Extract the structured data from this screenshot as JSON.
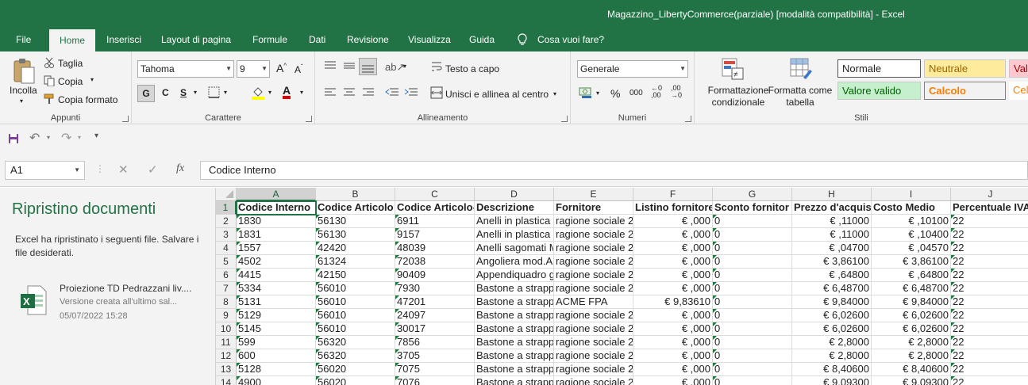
{
  "window": {
    "title": "Magazzino_LibertyCommerce(parziale)  [modalità compatibilità]  -  Excel"
  },
  "tabs": [
    "File",
    "Home",
    "Inserisci",
    "Layout di pagina",
    "Formule",
    "Dati",
    "Revisione",
    "Visualizza",
    "Guida",
    "Cosa vuoi fare?"
  ],
  "ribbon": {
    "clipboard": {
      "paste": "Incolla",
      "cut": "Taglia",
      "copy": "Copia",
      "format_painter": "Copia formato",
      "label": "Appunti"
    },
    "font": {
      "name": "Tahoma",
      "size": "9",
      "bold": "G",
      "italic": "C",
      "underline": "S",
      "label": "Carattere"
    },
    "alignment": {
      "wrap": "Testo a capo",
      "merge": "Unisci e allinea al centro",
      "label": "Allineamento"
    },
    "number": {
      "format": "Generale",
      "percent": "%",
      "thousands": "000",
      "label": "Numeri"
    },
    "styles": {
      "conditional": "Formattazione condizionale",
      "table": "Formatta come tabella",
      "label": "Stili",
      "items": [
        "Normale",
        "Neutrale",
        "Vale",
        "Valore valido",
        "Calcolo",
        "Cel"
      ]
    }
  },
  "formula_bar": {
    "name_box": "A1",
    "fx": "fx",
    "content": "Codice Interno"
  },
  "recovery": {
    "title": "Ripristino documenti",
    "desc": "Excel ha ripristinato i seguenti file. Salvare i file desiderati.",
    "file_name": "Proiezione TD Pedrazzani liv....",
    "file_version": "Versione creata all'ultimo sal...",
    "file_date": "05/07/2022 15:28"
  },
  "sheet": {
    "columns": [
      "A",
      "B",
      "C",
      "D",
      "E",
      "F",
      "G",
      "H",
      "I",
      "J"
    ],
    "rows": [
      [
        "Codice Interno",
        "Codice Articolo",
        "Codice Articolo-",
        "Descrizione",
        "Fornitore",
        "Listino fornitore",
        "Sconto fornitor",
        "Prezzo d'acquist",
        "Costo Medio",
        "Percentuale IVA"
      ],
      [
        "1830",
        "56130",
        "6911",
        "Anelli in plastica",
        "ragione sociale 2",
        "€ ,000",
        "0",
        "€ ,11000",
        "€ ,10100",
        "22"
      ],
      [
        "1831",
        "56130",
        "9157",
        "Anelli in plastica",
        "ragione sociale 2",
        "€ ,000",
        "0",
        "€ ,11000",
        "€ ,10400",
        "22"
      ],
      [
        "1557",
        "42420",
        "48039",
        "Anelli sagomati M",
        "ragione sociale 2",
        "€ ,000",
        "0",
        "€ ,04700",
        "€ ,04570",
        "22"
      ],
      [
        "4502",
        "61324",
        "72038",
        "Angoliera mod.A",
        "ragione sociale 2",
        "€ ,000",
        "0",
        "€ 3,86100",
        "€ 3,86100",
        "22"
      ],
      [
        "4415",
        "42150",
        "90409",
        "Appendiquadro g",
        "ragione sociale 2",
        "€ ,000",
        "0",
        "€ ,64800",
        "€ ,64800",
        "22"
      ],
      [
        "5334",
        "56010",
        "7930",
        "Bastone a strapp",
        "ragione sociale 2",
        "€ ,000",
        "0",
        "€ 6,48700",
        "€ 6,48700",
        "22"
      ],
      [
        "5131",
        "56010",
        "47201",
        "Bastone a strapp",
        "ACME FPA",
        "€ 9,83610",
        "0",
        "€ 9,84000",
        "€ 9,84000",
        "22"
      ],
      [
        "5129",
        "56010",
        "24097",
        "Bastone a strapp",
        "ragione sociale 2",
        "€ ,000",
        "0",
        "€ 6,02600",
        "€ 6,02600",
        "22"
      ],
      [
        "5145",
        "56010",
        "30017",
        "Bastone a strapp",
        "ragione sociale 2",
        "€ ,000",
        "0",
        "€ 6,02600",
        "€ 6,02600",
        "22"
      ],
      [
        "599",
        "56320",
        "7856",
        "Bastone a strapp",
        "ragione sociale 2",
        "€ ,000",
        "0",
        "€ 2,8000",
        "€ 2,8000",
        "22"
      ],
      [
        "600",
        "56320",
        "3705",
        "Bastone a strapp",
        "ragione sociale 2",
        "€ ,000",
        "0",
        "€ 2,8000",
        "€ 2,8000",
        "22"
      ],
      [
        "5128",
        "56020",
        "7075",
        "Bastone a strapp",
        "ragione sociale 2",
        "€ ,000",
        "0",
        "€ 8,40600",
        "€ 8,40600",
        "22"
      ],
      [
        "4900",
        "56020",
        "7076",
        "Bastone a strapp",
        "ragione sociale 2",
        "€ ,000",
        "0",
        "€ 9,09300",
        "€ 9,09300",
        "22"
      ]
    ]
  }
}
